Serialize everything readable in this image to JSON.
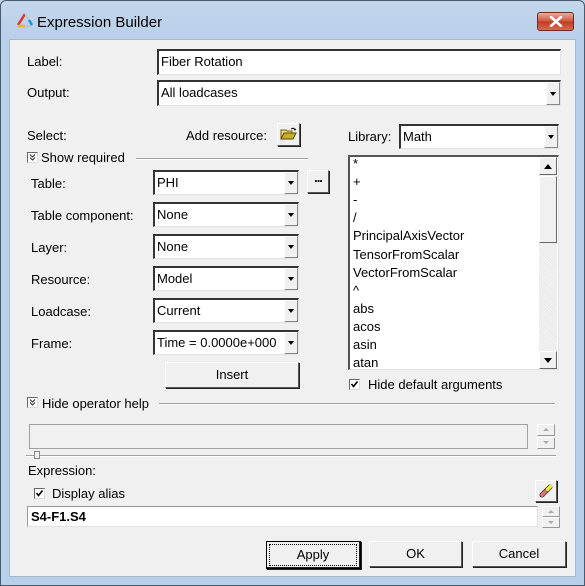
{
  "window": {
    "title": "Expression Builder",
    "close_icon": "close-x-icon",
    "app_icon": "triangle-logo-icon"
  },
  "label_field": {
    "label": "Label:",
    "value": "Fiber Rotation"
  },
  "output_field": {
    "label": "Output:",
    "value": "All loadcases"
  },
  "select_section": {
    "label": "Select:",
    "add_resource_label": "Add resource:",
    "add_resource_icon": "open-folder-icon",
    "show_required_label": "Show required",
    "fields": [
      {
        "label": "Table:",
        "value": "PHI"
      },
      {
        "label": "Table component:",
        "value": "None"
      },
      {
        "label": "Layer:",
        "value": "None"
      },
      {
        "label": "Resource:",
        "value": "Model"
      },
      {
        "label": "Loadcase:",
        "value": "Current"
      },
      {
        "label": "Frame:",
        "value": "Time = 0.0000e+000"
      }
    ],
    "table_more_button": "...",
    "insert_button": "Insert"
  },
  "library": {
    "label": "Library:",
    "value": "Math",
    "items": [
      "*",
      "+",
      "-",
      "/",
      "PrincipalAxisVector",
      "TensorFromScalar",
      "VectorFromScalar",
      "^",
      "abs",
      "acos",
      "asin",
      "atan"
    ],
    "hide_default_arguments_label": "Hide default arguments",
    "hide_default_arguments_checked": true
  },
  "operator_help": {
    "label": "Hide operator help",
    "text": ""
  },
  "expression": {
    "label": "Expression:",
    "display_alias_label": "Display alias",
    "display_alias_checked": true,
    "value": "S4-F1.S4",
    "edit_icon": "pencil-edit-icon"
  },
  "buttons": {
    "apply": "Apply",
    "ok": "OK",
    "cancel": "Cancel"
  }
}
